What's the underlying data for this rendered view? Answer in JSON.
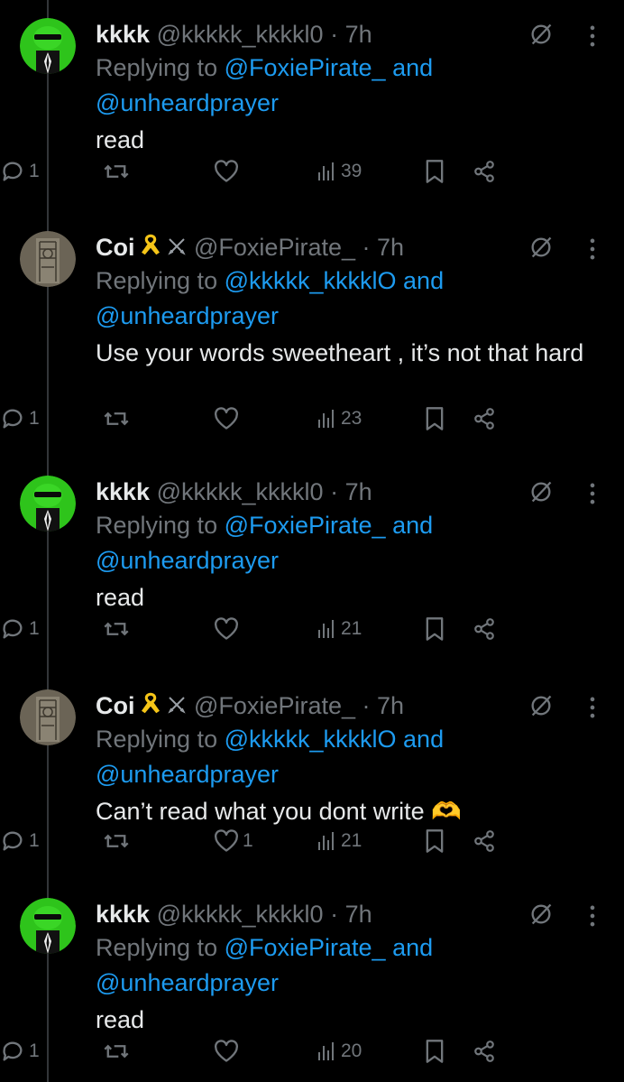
{
  "tweets": [
    {
      "name": "kkkk",
      "handle": "@kkkkk_kkkkl0",
      "dot": "·",
      "time": "7h",
      "replying_prefix": "Replying to ",
      "replying_user1": "@FoxiePirate_",
      "replying_and": " and",
      "replying_user2": "@unheardprayer",
      "text": "read",
      "replies": "1",
      "reposts": "",
      "likes": "",
      "views": "39",
      "avatar": "green-character-avatar"
    },
    {
      "name": "Coi",
      "handle": "@FoxiePirate_",
      "dot": "·",
      "time": "7h",
      "replying_prefix": "Replying to ",
      "replying_user1": "@kkkkk_kkkklO",
      "replying_and": " and",
      "replying_user2": "@unheardprayer",
      "text": "Use your words sweetheart , it’s not that hard",
      "replies": "1",
      "reposts": "",
      "likes": "",
      "views": "23",
      "avatar": "sketch-avatar"
    },
    {
      "name": "kkkk",
      "handle": "@kkkkk_kkkkl0",
      "dot": "·",
      "time": "7h",
      "replying_prefix": "Replying to ",
      "replying_user1": "@FoxiePirate_",
      "replying_and": " and",
      "replying_user2": "@unheardprayer",
      "text": "read",
      "replies": "1",
      "reposts": "",
      "likes": "",
      "views": "21",
      "avatar": "green-character-avatar"
    },
    {
      "name": "Coi",
      "handle": "@FoxiePirate_",
      "dot": "·",
      "time": "7h",
      "replying_prefix": "Replying to ",
      "replying_user1": "@kkkkk_kkkklO",
      "replying_and": " and",
      "replying_user2": "@unheardprayer",
      "text": "Can’t read what you dont write 🫶",
      "replies": "1",
      "reposts": "",
      "likes": "1",
      "views": "21",
      "avatar": "sketch-avatar"
    },
    {
      "name": "kkkk",
      "handle": "@kkkkk_kkkkl0",
      "dot": "·",
      "time": "7h",
      "replying_prefix": "Replying to ",
      "replying_user1": "@FoxiePirate_",
      "replying_and": " and",
      "replying_user2": "@unheardprayer",
      "text": "read",
      "replies": "1",
      "reposts": "",
      "likes": "",
      "views": "20",
      "avatar": "green-character-avatar"
    }
  ],
  "colors": {
    "background": "#000000",
    "text": "#e7e9ea",
    "muted": "#71767b",
    "link": "#1d9bf0",
    "avatar_green": "#2ec41b"
  }
}
